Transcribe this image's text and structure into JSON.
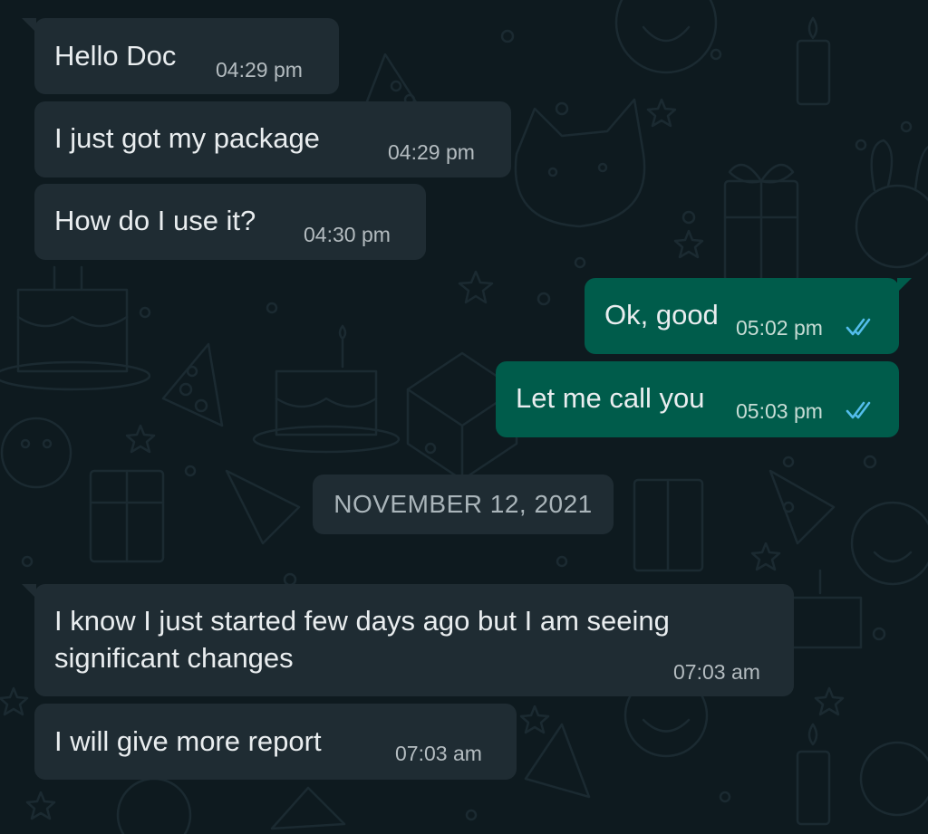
{
  "colors": {
    "background": "#0e1a1f",
    "incoming_bubble": "#1f2c33",
    "outgoing_bubble": "#005c4b",
    "read_tick": "#53bdeb"
  },
  "messages": [
    {
      "direction": "in",
      "text": "Hello Doc",
      "time": "04:29 pm"
    },
    {
      "direction": "in",
      "text": "I just got my package",
      "time": "04:29 pm"
    },
    {
      "direction": "in",
      "text": "How do I use it?",
      "time": "04:30 pm"
    },
    {
      "direction": "out",
      "text": "Ok, good",
      "time": "05:02 pm",
      "status_icon": "double-check-read-icon"
    },
    {
      "direction": "out",
      "text": "Let me call you",
      "time": "05:03 pm",
      "status_icon": "double-check-read-icon"
    },
    {
      "direction": "in",
      "text_lines": [
        "I know I just started few days ago but I am seeing",
        "significant changes"
      ],
      "time": "07:03 am"
    },
    {
      "direction": "in",
      "text": "I will give more report",
      "time": "07:03 am"
    }
  ],
  "date_divider": "NOVEMBER 12, 2021"
}
